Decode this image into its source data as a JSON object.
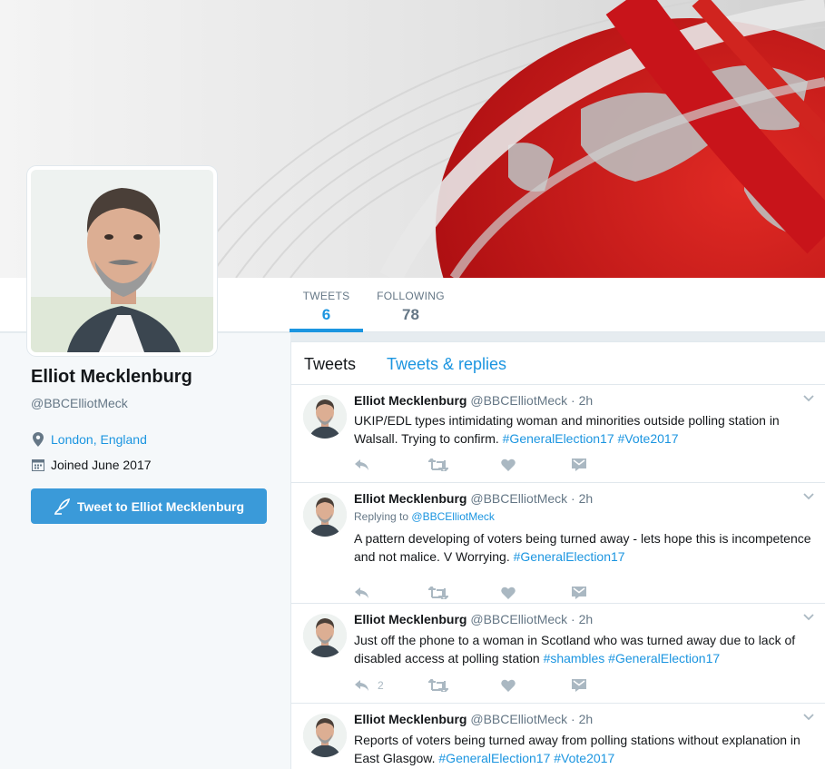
{
  "profile": {
    "name": "Elliot Mecklenburg",
    "handle": "@BBCElliotMeck",
    "location": "London, England",
    "joined": "Joined June 2017",
    "tweet_to_label": "Tweet to Elliot Mecklenburg"
  },
  "stats": {
    "tweets_label": "TWEETS",
    "tweets_value": "6",
    "following_label": "FOLLOWING",
    "following_value": "78"
  },
  "timeline_tabs": {
    "tweets": "Tweets",
    "tweets_replies": "Tweets & replies"
  },
  "colors": {
    "accent": "#1b95e0",
    "button": "#3a9ad9",
    "banner_red": "#c8141a"
  },
  "tweets": [
    {
      "name": "Elliot Mecklenburg",
      "handle": "@BBCElliotMeck",
      "time": "· 2h",
      "replying_label": "",
      "replying_handle": "",
      "text_plain_1": "UKIP/EDL types intimidating woman and minorities outside polling station in Walsall. Trying to confirm. ",
      "tag_1": "#GeneralElection17",
      "text_plain_2": " ",
      "tag_2": "#Vote2017",
      "reply_count": ""
    },
    {
      "name": "Elliot Mecklenburg",
      "handle": "@BBCElliotMeck",
      "time": "· 2h",
      "replying_label": "Replying to",
      "replying_handle": "@BBCElliotMeck",
      "text_plain_1": "A pattern developing of voters being turned away - lets hope this is incompetence and not malice. V Worrying. ",
      "tag_1": "#GeneralElection17",
      "text_plain_2": "",
      "tag_2": "",
      "reply_count": ""
    },
    {
      "name": "Elliot Mecklenburg",
      "handle": "@BBCElliotMeck",
      "time": "· 2h",
      "replying_label": "",
      "replying_handle": "",
      "text_plain_1": "Just off the phone to a woman in Scotland who was turned away due to lack of disabled access at polling station ",
      "tag_1": "#shambles",
      "text_plain_2": " ",
      "tag_2": "#GeneralElection17",
      "reply_count": "2"
    },
    {
      "name": "Elliot Mecklenburg",
      "handle": "@BBCElliotMeck",
      "time": "· 2h",
      "replying_label": "",
      "replying_handle": "",
      "text_plain_1": "Reports of voters being turned away from polling stations without explanation in East Glasgow. ",
      "tag_1": "#GeneralElection17",
      "text_plain_2": " ",
      "tag_2": "#Vote2017",
      "reply_count": ""
    }
  ]
}
